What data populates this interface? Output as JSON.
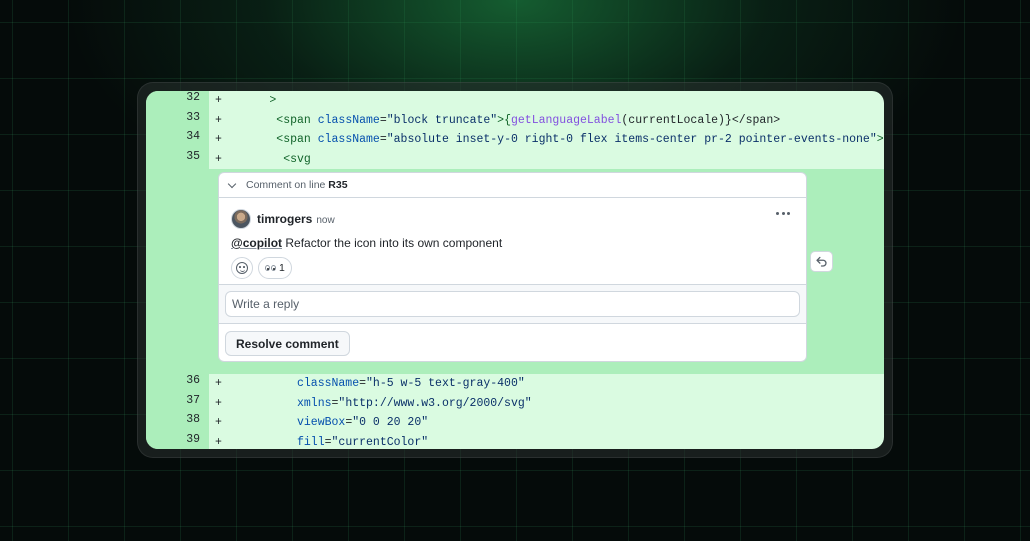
{
  "diff_lines_before": [
    {
      "num": "32",
      "sign": "+",
      "indent": 6,
      "code": [
        {
          "t": ">",
          "c": "tag"
        }
      ]
    },
    {
      "num": "33",
      "sign": "+",
      "indent": 7,
      "code": [
        {
          "t": "<span ",
          "c": "tag"
        },
        {
          "t": "className",
          "c": "attr"
        },
        {
          "t": "=",
          "c": ""
        },
        {
          "t": "\"block truncate\"",
          "c": "str"
        },
        {
          "t": ">{",
          "c": "tag"
        },
        {
          "t": "getLanguageLabel",
          "c": "fn"
        },
        {
          "t": "(currentLocale)}</span>",
          "c": ""
        }
      ]
    },
    {
      "num": "34",
      "sign": "+",
      "indent": 7,
      "code": [
        {
          "t": "<span ",
          "c": "tag"
        },
        {
          "t": "className",
          "c": "attr"
        },
        {
          "t": "=",
          "c": ""
        },
        {
          "t": "\"absolute inset-y-0 right-0 flex items-center pr-2 pointer-events-none\"",
          "c": "str"
        },
        {
          "t": ">",
          "c": "tag"
        }
      ]
    },
    {
      "num": "35",
      "sign": "+",
      "indent": 8,
      "code": [
        {
          "t": "<svg",
          "c": "tag"
        }
      ]
    }
  ],
  "diff_lines_after": [
    {
      "num": "36",
      "sign": "+",
      "indent": 10,
      "code": [
        {
          "t": "className",
          "c": "attr"
        },
        {
          "t": "=",
          "c": ""
        },
        {
          "t": "\"h-5 w-5 text-gray-400\"",
          "c": "str"
        }
      ]
    },
    {
      "num": "37",
      "sign": "+",
      "indent": 10,
      "code": [
        {
          "t": "xmlns",
          "c": "attr"
        },
        {
          "t": "=",
          "c": ""
        },
        {
          "t": "\"http://www.w3.org/2000/svg\"",
          "c": "str"
        }
      ]
    },
    {
      "num": "38",
      "sign": "+",
      "indent": 10,
      "code": [
        {
          "t": "viewBox",
          "c": "attr"
        },
        {
          "t": "=",
          "c": ""
        },
        {
          "t": "\"0 0 20 20\"",
          "c": "str"
        }
      ]
    },
    {
      "num": "39",
      "sign": "+",
      "indent": 10,
      "code": [
        {
          "t": "fill",
          "c": "attr"
        },
        {
          "t": "=",
          "c": ""
        },
        {
          "t": "\"currentColor\"",
          "c": "str"
        }
      ]
    }
  ],
  "thread": {
    "header_prefix": "Comment on line",
    "header_line": "R35",
    "author": "timrogers",
    "timestamp": "now",
    "mention": "@copilot",
    "body": "Refactor the icon into its own component",
    "reaction_count": "1",
    "reply_placeholder": "Write a reply",
    "resolve_label": "Resolve comment"
  },
  "icons": {
    "collapse": "chevron-down-icon",
    "more": "kebab-horizontal-icon",
    "add_reaction": "smiley-icon",
    "reaction": "eyes-emoji",
    "undo": "undo-icon"
  },
  "colors": {
    "added_line_bg": "#dafbe1",
    "added_gutter_bg": "#aceebb",
    "border": "#d0d7de"
  }
}
